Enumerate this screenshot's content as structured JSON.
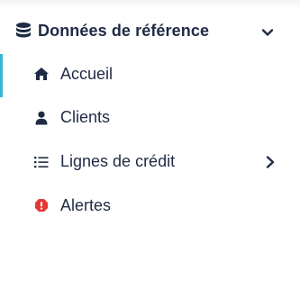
{
  "section": {
    "title": "Données de référence",
    "icon": "database-icon",
    "expand_icon": "chevron-down-icon"
  },
  "menu": {
    "items": [
      {
        "label": "Accueil",
        "icon": "home-icon",
        "active": true
      },
      {
        "label": "Clients",
        "icon": "user-icon",
        "active": false
      },
      {
        "label": "Lignes de crédit",
        "icon": "list-icon",
        "active": false,
        "has_submenu": true
      },
      {
        "label": "Alertes",
        "icon": "alert-octagon-icon",
        "active": false,
        "icon_color": "#e53935"
      }
    ]
  },
  "colors": {
    "text": "#1f2a44",
    "active_indicator": "#37b7d6",
    "alert": "#e53935"
  }
}
